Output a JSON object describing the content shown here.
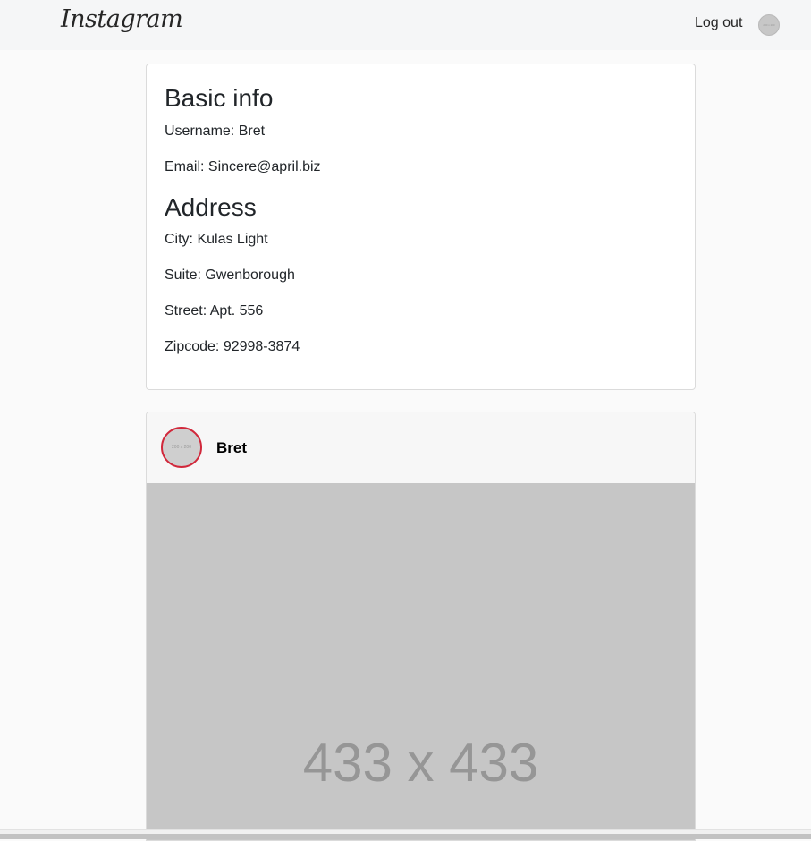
{
  "header": {
    "logo_text": "Instagram",
    "logout_label": "Log out",
    "avatar_placeholder": "200 x 200"
  },
  "basic_info": {
    "heading": "Basic info",
    "username": "Username: Bret",
    "email": "Email: Sincere@april.biz"
  },
  "address": {
    "heading": "Address",
    "city": "City: Kulas Light",
    "suite": "Suite: Gwenborough",
    "street": "Street: Apt. 556",
    "zipcode": "Zipcode: 92998-3874"
  },
  "post": {
    "username": "Bret",
    "avatar_placeholder": "200 x 200",
    "image_placeholder": "433 x 433"
  },
  "colors": {
    "avatar_ring": "#d1283b",
    "placeholder_bg": "#c6c6c6"
  }
}
